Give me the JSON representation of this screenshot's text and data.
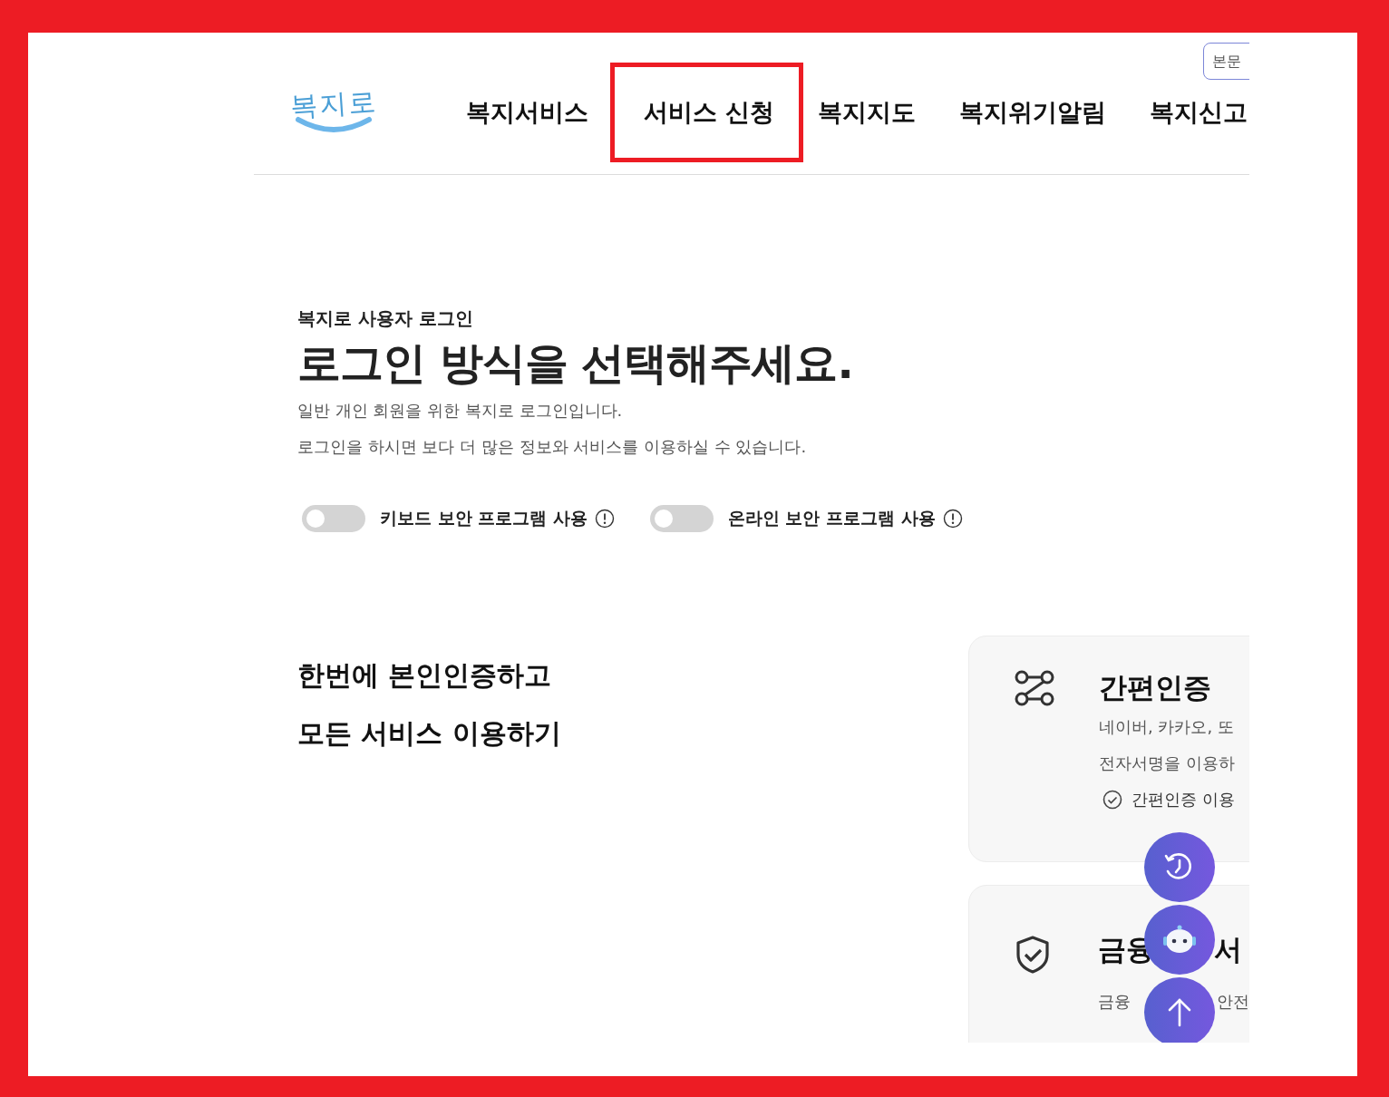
{
  "header": {
    "logo": "복지로",
    "skip_link": "본문",
    "nav": [
      {
        "label": "복지서비스",
        "highlighted": false
      },
      {
        "label": "서비스 신청",
        "highlighted": true
      },
      {
        "label": "복지지도",
        "highlighted": false
      },
      {
        "label": "복지위기알림",
        "highlighted": false
      },
      {
        "label": "복지신고",
        "highlighted": false
      }
    ]
  },
  "login": {
    "eyebrow": "복지로 사용자 로그인",
    "title": "로그인 방식을 선택해주세요.",
    "lines": [
      "일반 개인 회원을 위한 복지로 로그인입니다.",
      "로그인을 하시면 보다 더 많은 정보와 서비스를 이용하실 수 있습니다."
    ],
    "toggles": [
      {
        "label": "키보드 보안 프로그램 사용",
        "on": false
      },
      {
        "label": "온라인 보안 프로그램 사용",
        "on": false
      }
    ]
  },
  "intro": [
    "한번에 본인인증하고",
    "모든 서비스 이용하기"
  ],
  "cards": [
    {
      "kind": "simple",
      "title_parts": [
        "간편인증"
      ],
      "lines": [
        [
          "네이버, 카카오, 또"
        ],
        [
          "전자서명을 이용하"
        ]
      ],
      "action": "간편인증 이용"
    },
    {
      "kind": "finance",
      "title_parts": [
        "금융",
        "서"
      ],
      "lines": [
        [
          "금융",
          "안전"
        ]
      ]
    }
  ],
  "floating": [
    {
      "kind": "history"
    },
    {
      "kind": "chatbot"
    },
    {
      "kind": "top"
    }
  ]
}
